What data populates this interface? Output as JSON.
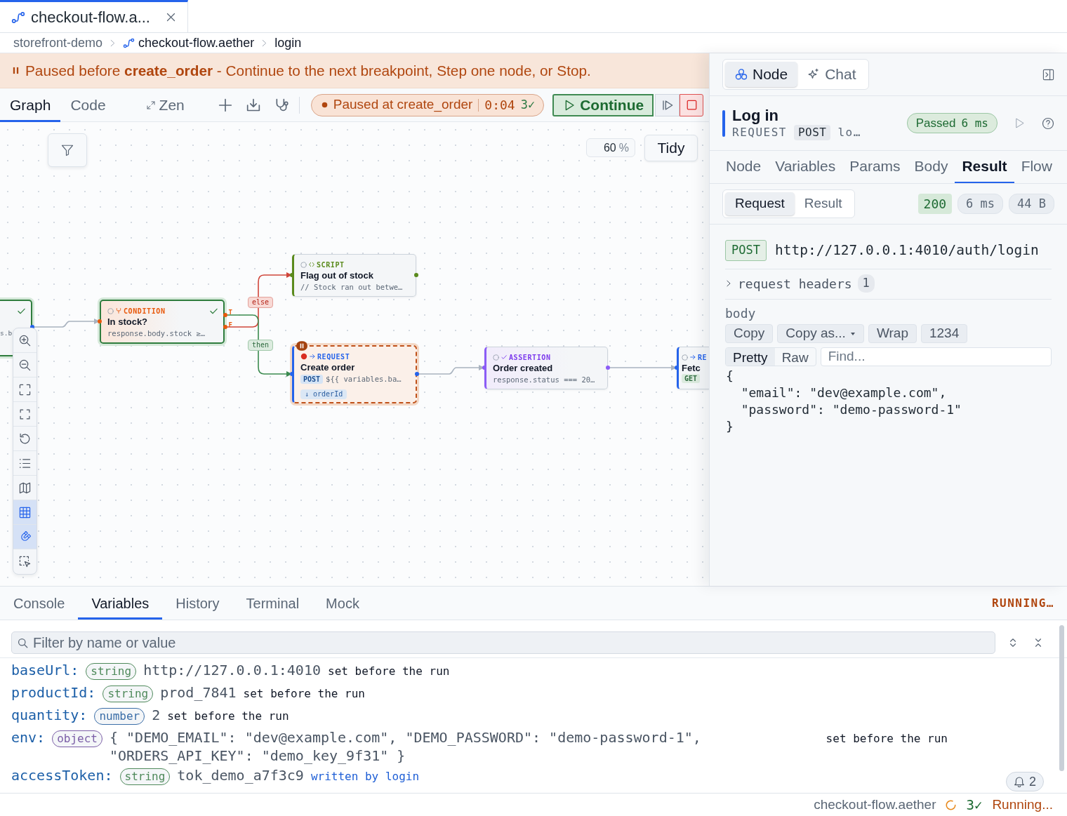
{
  "editor_tabs": [
    {
      "label": "checkout-flow.a...",
      "selected": true
    }
  ],
  "breadcrumb": [
    {
      "label": "storefront-demo",
      "kind": "folder"
    },
    {
      "label": "checkout-flow.aether",
      "kind": "flow"
    },
    {
      "label": "login",
      "kind": "node"
    }
  ],
  "banner": {
    "text": "Paused before **create_order** - Continue to the next breakpoint, Step one node, or Stop."
  },
  "toolbar": {
    "views": [
      {
        "label": "Graph",
        "selected": true
      },
      {
        "label": "Code",
        "selected": false
      }
    ],
    "zen": "Zen",
    "run_status": {
      "label": "Paused at create_order",
      "elapsed": "0:04",
      "passed": "3✓"
    },
    "continue": "Continue"
  },
  "canvas": {
    "zoom": "60",
    "zoom_unit": "%",
    "tidy": "Tidy",
    "tools": [
      {
        "kind": "zoom-in",
        "active": false
      },
      {
        "kind": "zoom-out",
        "active": false
      },
      {
        "kind": "fit",
        "active": false
      },
      {
        "kind": "fit-selection",
        "active": false
      },
      {
        "kind": "reset",
        "active": false
      },
      {
        "kind": "outline",
        "active": false
      },
      {
        "kind": "minimap",
        "active": false
      },
      {
        "kind": "grid",
        "active": true
      },
      {
        "kind": "snap",
        "active": true
      },
      {
        "kind": "select",
        "active": false
      }
    ],
    "nodes": [
      {
        "detail": "s.b",
        "passed": true,
        "paused": false,
        "breakpoint": false
      },
      {
        "kind": "condition",
        "type_label": "CONDITION",
        "title": "In stock?",
        "detail": "response.body.stock ≥…",
        "passed": true,
        "paused": false,
        "breakpoint": false,
        "ports": [
          "T",
          "F"
        ]
      },
      {
        "kind": "script",
        "type_label": "SCRIPT",
        "title": "Flag out of stock",
        "detail": "// Stock ran out betwe…",
        "passed": false,
        "paused": false,
        "breakpoint": false
      },
      {
        "kind": "request",
        "type_label": "REQUEST",
        "title": "Create order",
        "method": "POST",
        "detail": "${{ variables.ba…",
        "output": "↓ orderId",
        "passed": false,
        "paused": true,
        "breakpoint": true
      },
      {
        "kind": "assertion",
        "type_label": "ASSERTION",
        "title": "Order created",
        "detail": "response.status === 20…",
        "passed": false,
        "paused": false,
        "breakpoint": false
      },
      {
        "kind": "request",
        "type_label": "RE",
        "title": "Fetc",
        "method": "GET",
        "passed": false,
        "paused": false,
        "breakpoint": false
      }
    ],
    "edge_labels": [
      {
        "label": "else",
        "kind": "else"
      },
      {
        "label": "then",
        "kind": "then"
      }
    ]
  },
  "inspector": {
    "modes": [
      {
        "label": "Node",
        "kind": "node",
        "selected": true
      },
      {
        "label": "Chat",
        "kind": "chat",
        "selected": false
      }
    ],
    "node": {
      "title": "Log in",
      "type_label": "REQUEST",
      "method": "POST",
      "target": "lo…",
      "status": "Passed",
      "duration": "6 ms"
    },
    "tabs": [
      {
        "label": "Node",
        "selected": false
      },
      {
        "label": "Variables",
        "selected": false
      },
      {
        "label": "Params",
        "selected": false
      },
      {
        "label": "Body",
        "selected": false
      },
      {
        "label": "Result",
        "selected": true
      },
      {
        "label": "Flow",
        "selected": false
      }
    ],
    "views": [
      {
        "label": "Request",
        "selected": true
      },
      {
        "label": "Result",
        "selected": false
      }
    ],
    "response": {
      "status_code": "200",
      "time": "6 ms",
      "size": "44 B"
    },
    "request": {
      "method": "POST",
      "url": "http://127.0.0.1:4010/auth/login",
      "headers_label": "request headers",
      "headers_count": "1",
      "expanded": false,
      "body_label": "body",
      "actions": [
        {
          "label": "Copy",
          "kind": "plain"
        },
        {
          "label": "Copy as...",
          "kind": "menu"
        },
        {
          "label": "Wrap",
          "kind": "plain"
        },
        {
          "label": "1234",
          "kind": "plain"
        }
      ],
      "formats": [
        {
          "label": "Pretty",
          "selected": true
        },
        {
          "label": "Raw",
          "selected": false
        }
      ],
      "find_placeholder": "Find...",
      "body_lines": [
        "{",
        "  \"email\": \"dev@example.com\",",
        "  \"password\": \"demo-password-1\"",
        "}"
      ]
    }
  },
  "bottom_panel": {
    "tabs": [
      {
        "label": "Console",
        "selected": false
      },
      {
        "label": "Variables",
        "selected": true
      },
      {
        "label": "History",
        "selected": false
      },
      {
        "label": "Terminal",
        "selected": false
      },
      {
        "label": "Mock",
        "selected": false
      }
    ],
    "run_state": "RUNNING…",
    "filter_placeholder": "Filter by name or value",
    "variables": [
      {
        "name": "baseUrl:",
        "type": "string",
        "color": "#4f8a5b",
        "value": "http://127.0.0.1:4010",
        "origin": "set before the run",
        "kind": "preset"
      },
      {
        "name": "productId:",
        "type": "string",
        "color": "#4f8a5b",
        "value": "prod_7841",
        "origin": "set before the run",
        "kind": "preset"
      },
      {
        "name": "quantity:",
        "type": "number",
        "color": "#3b6ea8",
        "value": "2",
        "origin": "set before the run",
        "kind": "preset"
      },
      {
        "name": "env:",
        "type": "object",
        "color": "#7b5ea7",
        "value": "{ \"DEMO_EMAIL\": \"dev@example.com\", \"DEMO_PASSWORD\": \"demo-password-1\", \"ORDERS_API_KEY\": \"demo_key_9f31\" }",
        "origin": "set before the run",
        "kind": "preset"
      },
      {
        "name": "accessToken:",
        "type": "string",
        "color": "#4f8a5b",
        "value": "tok_demo_a7f3c9",
        "origin": "written by login",
        "kind": "written"
      }
    ],
    "notifications": "2"
  },
  "status_bar": {
    "file": "checkout-flow.aether",
    "passed": "3✓",
    "state": "Running..."
  }
}
